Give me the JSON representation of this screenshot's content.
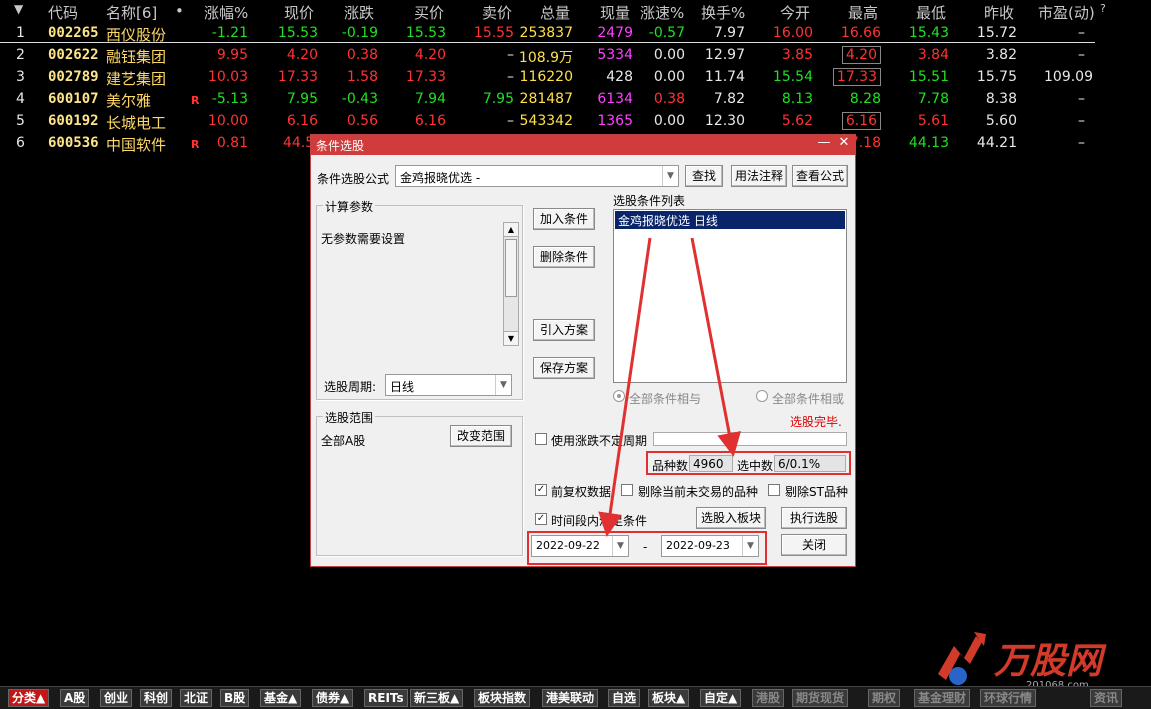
{
  "header": {
    "arrow": "▼",
    "code": "代码",
    "name": "名称[6]",
    "dot": "•",
    "pct": "涨幅%",
    "price": "现价",
    "chg": "涨跌",
    "bid": "买价",
    "ask": "卖价",
    "vol": "总量",
    "cur": "现量",
    "speed": "涨速%",
    "turn": "换手%",
    "open": "今开",
    "high": "最高",
    "low": "最低",
    "prev": "昨收",
    "pe": "市盈(动)",
    "q": "?"
  },
  "rows": [
    {
      "idx": "1",
      "code": "002265",
      "name": "西仪股份",
      "r": "",
      "pct": "-1.21",
      "price": "15.53",
      "chg": "-0.19",
      "bid": "15.53",
      "ask": "15.55",
      "vol": "253837",
      "cur": "2479",
      "speed": "-0.57",
      "turn": "7.97",
      "open": "16.00",
      "high": "16.66",
      "low": "15.43",
      "prev": "15.72",
      "pe": "–"
    },
    {
      "idx": "2",
      "code": "002622",
      "name": "融钰集团",
      "r": "",
      "pct": "9.95",
      "price": "4.20",
      "chg": "0.38",
      "bid": "4.20",
      "ask": "–",
      "vol": "108.9万",
      "cur": "5334",
      "speed": "0.00",
      "turn": "12.97",
      "open": "3.85",
      "high": "4.20",
      "low": "3.84",
      "prev": "3.82",
      "pe": "–"
    },
    {
      "idx": "3",
      "code": "002789",
      "name": "建艺集团",
      "r": "",
      "pct": "10.03",
      "price": "17.33",
      "chg": "1.58",
      "bid": "17.33",
      "ask": "–",
      "vol": "116220",
      "cur": "428",
      "speed": "0.00",
      "turn": "11.74",
      "open": "15.54",
      "high": "17.33",
      "low": "15.51",
      "prev": "15.75",
      "pe": "109.09"
    },
    {
      "idx": "4",
      "code": "600107",
      "name": "美尔雅",
      "r": "R",
      "pct": "-5.13",
      "price": "7.95",
      "chg": "-0.43",
      "bid": "7.94",
      "ask": "7.95",
      "vol": "281487",
      "cur": "6134",
      "speed": "0.38",
      "turn": "7.82",
      "open": "8.13",
      "high": "8.28",
      "low": "7.78",
      "prev": "8.38",
      "pe": "–"
    },
    {
      "idx": "5",
      "code": "600192",
      "name": "长城电工",
      "r": "",
      "pct": "10.00",
      "price": "6.16",
      "chg": "0.56",
      "bid": "6.16",
      "ask": "–",
      "vol": "543342",
      "cur": "1365",
      "speed": "0.00",
      "turn": "12.30",
      "open": "5.62",
      "high": "6.16",
      "low": "5.61",
      "prev": "5.60",
      "pe": "–"
    },
    {
      "idx": "6",
      "code": "600536",
      "name": "中国软件",
      "r": "R",
      "pct": "0.81",
      "price": "44.5",
      "chg": "",
      "bid": "",
      "ask": "",
      "vol": "",
      "cur": "",
      "speed": "",
      "turn": "",
      "open": "",
      "high": "7.18",
      "low": "44.13",
      "prev": "44.21",
      "pe": "–"
    }
  ],
  "dialog": {
    "title": "条件选股",
    "min": "—",
    "close": "✕",
    "formula_label": "条件选股公式",
    "formula_value": "金鸡报晓优选 -",
    "find": "查找",
    "usage": "用法注释",
    "view": "查看公式",
    "params_group": "计算参数",
    "params_text": "无参数需要设置",
    "period_label": "选股周期:",
    "period_value": "日线",
    "add": "加入条件",
    "del": "删除条件",
    "import": "引入方案",
    "save": "保存方案",
    "list_label": "选股条件列表",
    "list_item": "金鸡报晓优选  日线",
    "radio_and": "全部条件相与",
    "radio_or": "全部条件相或",
    "status": "选股完毕.",
    "scope_group": "选股范围",
    "scope_value": "全部A股",
    "change_scope": "改变范围",
    "use_period": "使用涨跌不定周期",
    "count_label": "品种数",
    "count_value": "4960",
    "selected_label": "选中数",
    "selected_value": "6/0.1%",
    "fq": "前复权数据",
    "exclude_notrade": "剔除当前未交易的品种",
    "exclude_st": "剔除ST品种",
    "time_cond": "时间段内满足条件",
    "to_block": "选股入板块",
    "run": "执行选股",
    "date_from": "2022-09-22",
    "dash": "-",
    "date_to": "2022-09-23",
    "close_btn": "关闭"
  },
  "tabs": [
    "分类▲",
    "A股",
    "创业",
    "科创",
    "北证",
    "B股",
    "基金▲",
    "债券▲",
    "REITs",
    "新三板▲",
    "板块指数",
    "港美联动",
    "自选",
    "板块▲",
    "自定▲",
    "港股",
    "期货现货",
    "期权",
    "基金理财",
    "环球行情",
    "资讯"
  ],
  "logo": {
    "text": "万股网",
    "url": "201068.com"
  },
  "colors": {
    "up": "#ff3333",
    "down": "#21e021",
    "accent": "#d13b3b"
  }
}
